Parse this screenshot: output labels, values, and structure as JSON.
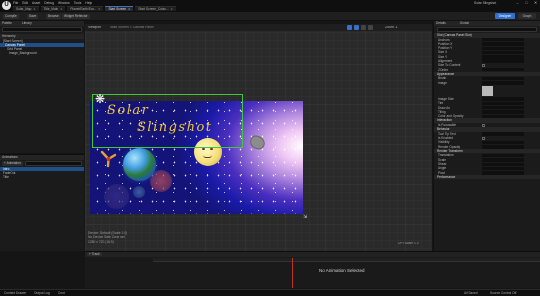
{
  "app": {
    "logo": "U",
    "project": "Solar Slingshot"
  },
  "menu": [
    "File",
    "Edit",
    "Asset",
    "Debug",
    "Window",
    "Tools",
    "Help"
  ],
  "doc_tabs": [
    {
      "label": "Solar_Map",
      "active": false
    },
    {
      "label": "Title_Main",
      "active": false
    },
    {
      "label": "Planet/Earth/Ear...",
      "active": false
    },
    {
      "label": "Start Screen",
      "active": true
    },
    {
      "label": "Start Screen_Cutsc...",
      "active": false
    }
  ],
  "toolbar": {
    "items": [
      "Compile",
      "Save",
      "Browse",
      "Widget Reflector"
    ],
    "compile_label": "Designer",
    "graph_label": "Graph"
  },
  "palette": {
    "title": "Palette",
    "library_tab": "Library"
  },
  "hierarchy": {
    "title": "Hierarchy",
    "rows": [
      {
        "label": "[Start Screen]",
        "selected": false
      },
      {
        "label": "Canvas Panel",
        "selected": true
      },
      {
        "label": "Grid Panel",
        "selected": false
      },
      {
        "label": "Image_Background",
        "selected": false
      }
    ]
  },
  "animations": {
    "title": "Animations",
    "add_label": "+ Animation",
    "rows": [
      "Intro",
      "FadeOut",
      "Title"
    ]
  },
  "viewport": {
    "tab": "Viewport",
    "breadcrumb": "Start Screen > Canvas Panel",
    "zoom": "Zoom -1",
    "info_lines": [
      "Device: Default (Scale 1.0)",
      "No Device Safe Zone set",
      "1280 x 720 (16:9)"
    ],
    "dpi": "DPI Scale 1.0",
    "title_line1": "Solar",
    "title_line2": "Slingshot",
    "handle_glyph": "❋"
  },
  "details": {
    "tab": "Details",
    "tab2": "Global",
    "search_placeholder": "Search Details",
    "sections": [
      {
        "name": "Slot (Canvas Panel Slot)",
        "rows": [
          "Anchors",
          "Position X",
          "Position Y",
          "Size X",
          "Size Y",
          "Alignment",
          "Size To Content",
          "ZOrder"
        ]
      },
      {
        "name": "Appearance",
        "rows": [
          "Brush",
          "Image",
          "Image Size",
          "Tint",
          "Draw As",
          "Tiling",
          "Color and Opacity"
        ]
      },
      {
        "name": "Interaction",
        "rows": [
          "Is Focusable"
        ]
      },
      {
        "name": "Behavior",
        "rows": [
          "Tool Tip Text",
          "Is Enabled",
          "Visibility",
          "Render Opacity"
        ]
      },
      {
        "name": "Render Transform",
        "rows": [
          "Translation",
          "Scale",
          "Shear",
          "Angle",
          "Pivot"
        ]
      },
      {
        "name": "Performance",
        "rows": []
      }
    ]
  },
  "timeline": {
    "empty": "No Animation Selected",
    "add_track": "+ Track"
  },
  "statusbar": {
    "left": [
      "Content Drawer",
      "Output Log",
      "Cmd"
    ],
    "right": [
      "Source Control Off"
    ],
    "add": "All Saved"
  },
  "colors": {
    "accent": "#2f6fd1",
    "selection": "#3fc83f",
    "title_text": "#f2c53a"
  }
}
